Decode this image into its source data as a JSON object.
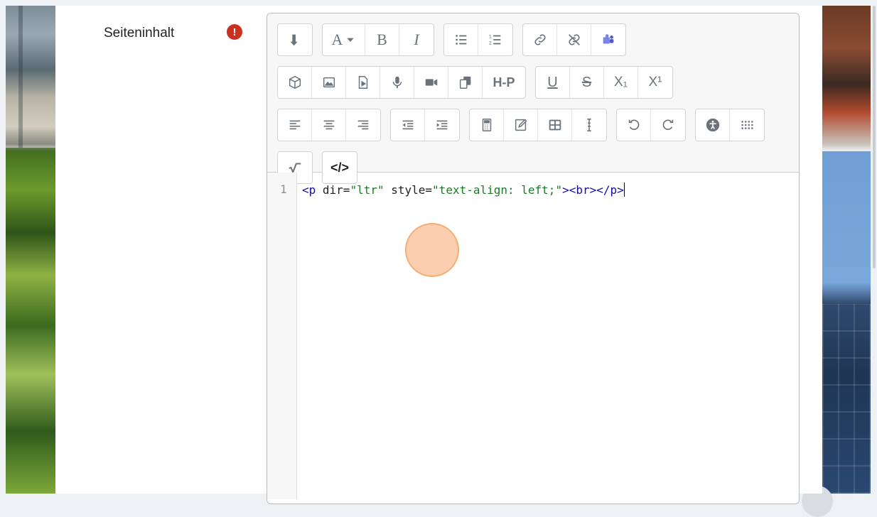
{
  "form": {
    "field_label": "Seiteninhalt",
    "required_symbol": "!"
  },
  "toolbar": {
    "row1": [
      {
        "name": "toolbar-toggle",
        "icon": "arrow-down-icon"
      },
      {
        "name": "font-style",
        "icon": "font-dropdown-icon",
        "label": "A"
      },
      {
        "name": "bold",
        "label": "B"
      },
      {
        "name": "italic",
        "label": "I"
      },
      {
        "name": "unordered-list",
        "icon": "bullet-list-icon"
      },
      {
        "name": "ordered-list",
        "icon": "numbered-list-icon"
      },
      {
        "name": "link",
        "icon": "link-icon"
      },
      {
        "name": "unlink",
        "icon": "unlink-icon"
      },
      {
        "name": "teams",
        "icon": "teams-icon"
      }
    ],
    "row2": [
      {
        "name": "embed",
        "icon": "cube-icon"
      },
      {
        "name": "image",
        "icon": "image-icon"
      },
      {
        "name": "media",
        "icon": "file-media-icon"
      },
      {
        "name": "record-audio",
        "icon": "microphone-icon"
      },
      {
        "name": "record-video",
        "icon": "video-camera-icon"
      },
      {
        "name": "copy",
        "icon": "copy-icon"
      },
      {
        "name": "h5p",
        "label": "H-P"
      },
      {
        "name": "underline",
        "label": "U"
      },
      {
        "name": "strikethrough",
        "label": "S"
      },
      {
        "name": "subscript",
        "label": "X₁"
      },
      {
        "name": "superscript",
        "label": "X¹"
      }
    ],
    "row3": [
      {
        "name": "align-left",
        "icon": "align-left-icon"
      },
      {
        "name": "align-center",
        "icon": "align-center-icon"
      },
      {
        "name": "align-right",
        "icon": "align-right-icon"
      },
      {
        "name": "outdent",
        "icon": "outdent-icon"
      },
      {
        "name": "indent",
        "icon": "indent-icon"
      },
      {
        "name": "calculator",
        "icon": "calculator-icon"
      },
      {
        "name": "edit",
        "icon": "pencil-icon"
      },
      {
        "name": "table",
        "icon": "table-icon"
      },
      {
        "name": "clear-formatting",
        "icon": "text-cursor-icon"
      },
      {
        "name": "undo",
        "icon": "undo-icon"
      },
      {
        "name": "redo",
        "icon": "redo-icon"
      },
      {
        "name": "accessibility",
        "icon": "accessibility-icon"
      },
      {
        "name": "special-chars",
        "icon": "grid-dots-icon"
      }
    ],
    "row4": [
      {
        "name": "equation",
        "icon": "square-root-icon"
      },
      {
        "name": "html-source",
        "label": "</>"
      }
    ]
  },
  "code_editor": {
    "line_number": "1",
    "tokens": [
      {
        "type": "tag",
        "text": "<p"
      },
      {
        "type": "attr",
        "text": " dir="
      },
      {
        "type": "str",
        "text": "\"ltr\""
      },
      {
        "type": "attr",
        "text": " style="
      },
      {
        "type": "str",
        "text": "\"text-align: left;\""
      },
      {
        "type": "tag",
        "text": "><br></p>"
      }
    ]
  },
  "colors": {
    "required": "#ca3120",
    "tag": "#170b9e",
    "string": "#1c7c25",
    "click_indicator": "#fabe96"
  }
}
